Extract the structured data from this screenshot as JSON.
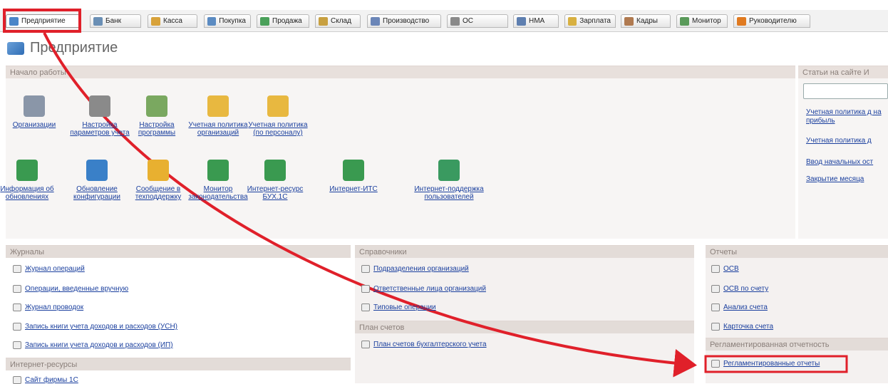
{
  "tabs": [
    {
      "label": "Предприятие",
      "color": "#4a86c8"
    },
    {
      "label": "Банк",
      "color": "#6a8fb5"
    },
    {
      "label": "Касса",
      "color": "#d8a23a"
    },
    {
      "label": "Покупка",
      "color": "#5b8bc2"
    },
    {
      "label": "Продажа",
      "color": "#4aa05a"
    },
    {
      "label": "Склад",
      "color": "#c8a040"
    },
    {
      "label": "Производство",
      "color": "#6b86b8"
    },
    {
      "label": "ОС",
      "color": "#8a8a8a"
    },
    {
      "label": "НМА",
      "color": "#5e7fb0"
    },
    {
      "label": "Зарплата",
      "color": "#d8b040"
    },
    {
      "label": "Кадры",
      "color": "#b07a50"
    },
    {
      "label": "Монитор",
      "color": "#5a9a5a"
    },
    {
      "label": "Руководителю",
      "color": "#e07a20"
    }
  ],
  "page_title": "Предприятие",
  "start": {
    "title": "Начало работы",
    "row1": [
      {
        "label": "Организации",
        "color": "#8a96a8"
      },
      {
        "label": "Настройка параметров учета",
        "color": "#8a8a8a"
      },
      {
        "label": "Настройка программы",
        "color": "#7aa860"
      },
      {
        "label": "Учетная политика организаций",
        "color": "#e8b840"
      },
      {
        "label": "Учетная политика (по персоналу)",
        "color": "#e8b840"
      }
    ],
    "row2": [
      {
        "label": "Информация об обновлениях",
        "color": "#3a9a50"
      },
      {
        "label": "Обновление конфигурации",
        "color": "#3a80c8"
      },
      {
        "label": "Сообщение в техподдержку",
        "color": "#e8b030"
      },
      {
        "label": "Монитор законодательства",
        "color": "#3a9a50"
      },
      {
        "label": "Интернет-ресурс БУХ.1С",
        "color": "#3a9a50"
      },
      {
        "label": "Интернет-ИТС",
        "color": "#3a9a50"
      },
      {
        "label": "Интернет-поддержка пользователей",
        "color": "#3a9a60"
      }
    ]
  },
  "side": {
    "title": "Статьи на сайте И",
    "links": [
      "Учетная политика д на прибыль",
      "Учетная политика д",
      "Ввод начальных ост",
      "Закрытие месяца"
    ]
  },
  "journals": {
    "title": "Журналы",
    "items": [
      "Журнал операций",
      "Операции, введенные вручную",
      "Журнал проводок",
      "Запись книги учета доходов и расходов (УСН)",
      "Запись книги учета доходов и расходов (ИП)"
    ]
  },
  "internet": {
    "title": "Интернет-ресурсы",
    "items": [
      "Сайт фирмы 1С"
    ]
  },
  "refs": {
    "title": "Справочники",
    "items": [
      "Подразделения организаций",
      "Ответственные лица организаций",
      "Типовые операции"
    ]
  },
  "accounts": {
    "title": "План счетов",
    "items": [
      "План счетов бухгалтерского учета"
    ]
  },
  "reports": {
    "title": "Отчеты",
    "items": [
      "ОСВ",
      "ОСВ по счету",
      "Анализ счета",
      "Карточка счета"
    ]
  },
  "reg": {
    "title": "Регламентированная отчетность",
    "items": [
      "Регламентированные отчеты"
    ]
  },
  "highlight_color": "#e0202a"
}
